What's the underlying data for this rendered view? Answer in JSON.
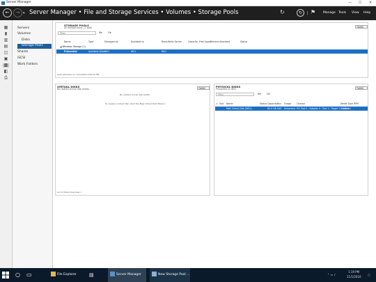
{
  "window": {
    "title": "Server Manager",
    "minimize": "—",
    "maximize": "☐",
    "close": "✕"
  },
  "header": {
    "breadcrumb": "Server Manager • File and Storage Services • Volumes • Storage Pools",
    "menus": [
      "Manage",
      "Tools",
      "View",
      "Help"
    ]
  },
  "nav": {
    "items": [
      {
        "label": "Servers"
      },
      {
        "label": "Volumes"
      },
      {
        "label": "Disks"
      },
      {
        "label": "Storage Pools"
      },
      {
        "label": "Shares"
      },
      {
        "label": "iSCSI"
      },
      {
        "label": "Work Folders"
      }
    ]
  },
  "storage_pools": {
    "title": "STORAGE POOLS",
    "subtitle": "All storage pools | 1 total",
    "tasks": "TASKS",
    "filter_placeholder": "Filter",
    "columns": [
      "Name",
      "Type",
      "Managed by",
      "Available to",
      "Read-Write Server",
      "Capacity",
      "Free Space",
      "Percent Allocated",
      "Status"
    ],
    "group": "Windows Storage (1)",
    "row": [
      "Primordial",
      "Available Disks",
      "WS1",
      "WS1",
      "WS1"
    ],
    "footer": "Last refreshed on 11/1/2016 3:00:53 PM"
  },
  "virtual_disks": {
    "title": "VIRTUAL DISKS",
    "subtitle": "No related virtual disk exists.",
    "tasks": "TASKS",
    "empty1": "No related virtual disk exists.",
    "empty2": "To create a virtual disk, start the New Virtual Disk Wizard.",
    "footer": "Go to Disks Overview >"
  },
  "physical_disks": {
    "title": "PHYSICAL DISKS",
    "subtitle": "Primordial on WS1",
    "tasks": "TASKS",
    "filter_placeholder": "Filter",
    "columns": [
      "Slot",
      "Name",
      "Status",
      "Capacity",
      "Bus",
      "Usage",
      "Chassis",
      "Media Type",
      "RPM"
    ],
    "row": [
      "",
      "Msft Virtual Disk (WS1)",
      "",
      "80.0 GB",
      "SAS",
      "Automatic",
      "PCI Slot 0 : Adapter 0 : Port 1 : Target 1 : LUN 0",
      "Unknown",
      ""
    ]
  },
  "taskbar": {
    "items": [
      {
        "label": "File Explorer"
      },
      {
        "label": "Server Manager"
      },
      {
        "label": "New Storage Pool ..."
      }
    ],
    "time": "1:19 PM",
    "date": "11/1/2016"
  },
  "colors": {
    "header": "#1f1f1f",
    "selection": "#1e6fc4",
    "nav_selected": "#1e5c9e",
    "taskbar": "#0b1a2a"
  }
}
